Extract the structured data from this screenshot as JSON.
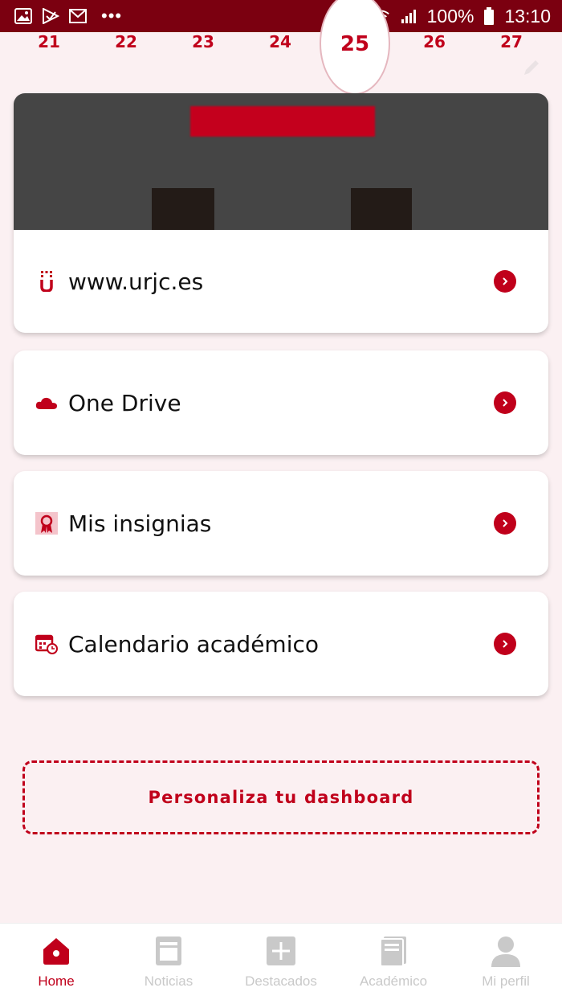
{
  "status_bar": {
    "battery": "100%",
    "time": "13:10"
  },
  "week": {
    "days": [
      "21",
      "22",
      "23",
      "24",
      "25",
      "26",
      "27"
    ],
    "selected_day": "25"
  },
  "cards": [
    {
      "label": "www.urjc.es",
      "icon": "urjc-logo-icon"
    },
    {
      "label": "One Drive",
      "icon": "cloud-icon"
    },
    {
      "label": "Mis insignias",
      "icon": "badge-icon"
    },
    {
      "label": "Calendario académico",
      "icon": "calendar-icon"
    }
  ],
  "personalize_label": "Personaliza tu dashboard",
  "bottom_nav": [
    {
      "label": "Home",
      "icon": "home-icon",
      "active": true
    },
    {
      "label": "Noticias",
      "icon": "news-icon",
      "active": false
    },
    {
      "label": "Destacados",
      "icon": "plus-icon",
      "active": false
    },
    {
      "label": "Académico",
      "icon": "book-icon",
      "active": false
    },
    {
      "label": "Mi perfil",
      "icon": "profile-icon",
      "active": false
    }
  ],
  "colors": {
    "accent": "#c0001b",
    "status_bar": "#7b0010",
    "background": "#fbf0f2",
    "inactive": "#c9c9c9"
  }
}
